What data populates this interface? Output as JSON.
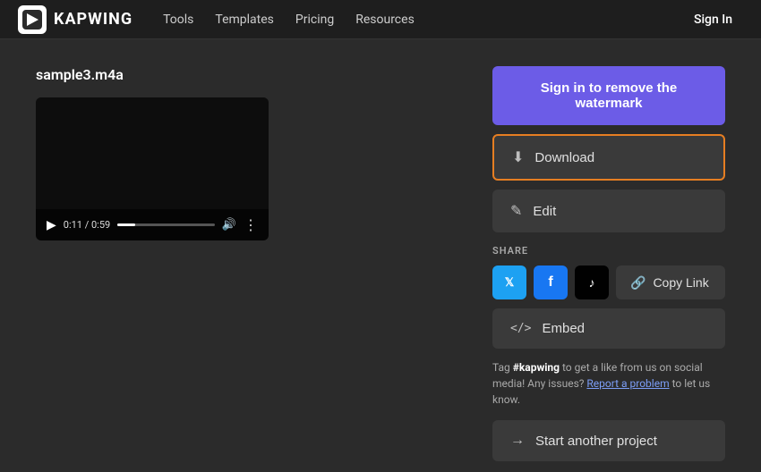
{
  "header": {
    "logo_text": "KAPWING",
    "nav_items": [
      "Tools",
      "Templates",
      "Pricing",
      "Resources"
    ],
    "sign_in_label": "Sign In"
  },
  "main": {
    "project_title": "sample3.m4a",
    "video": {
      "time_current": "0:11",
      "time_total": "0:59",
      "progress_percent": 18
    },
    "watermark_btn_label": "Sign in to remove the watermark",
    "download_btn_label": "Download",
    "edit_btn_label": "Edit",
    "share_label": "SHARE",
    "copy_link_label": "Copy Link",
    "embed_btn_label": "Embed",
    "tag_text_prefix": "Tag ",
    "tag_hashtag": "#kapwing",
    "tag_text_mid": " to get a like from us on social media! Any issues? ",
    "tag_link": "Report a problem",
    "tag_text_suffix": " to let us know.",
    "start_project_label": "Start another project"
  },
  "icons": {
    "play": "▶",
    "volume": "🔊",
    "more": "⋮",
    "download": "⬇",
    "edit": "✎",
    "link": "🔗",
    "code": "</>",
    "arrow": "→",
    "twitter": "𝕏",
    "facebook": "f",
    "tiktok": "♪"
  }
}
